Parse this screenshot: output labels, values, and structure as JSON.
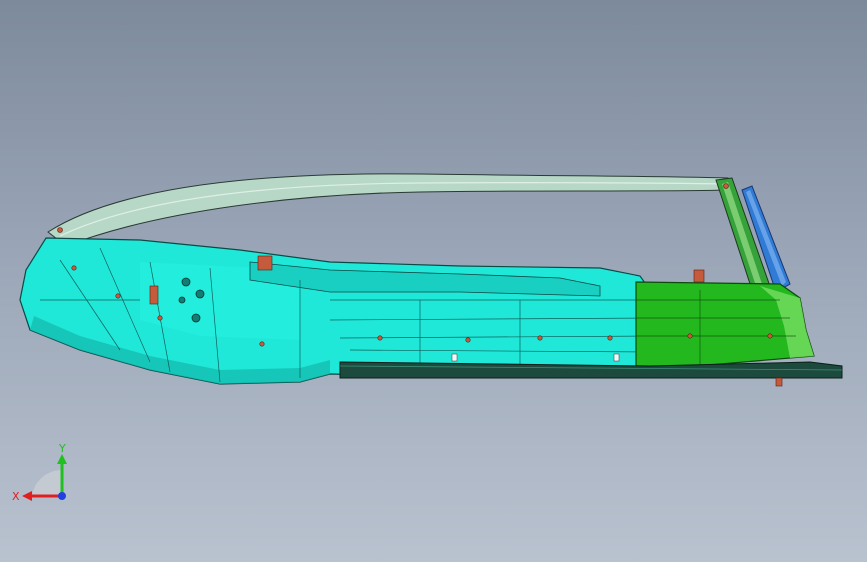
{
  "viewport": {
    "background_top": "#7d8a9c",
    "background_bottom": "#b9c2cf"
  },
  "model": {
    "part_colors": {
      "main_body": "#1fe8d8",
      "rear_section": "#22b81e",
      "frame_rail": "#b9d9c9",
      "bracket": "#2f7bd6",
      "fastener": "#c65a3c"
    }
  },
  "triad": {
    "x_label": "X",
    "y_label": "Y",
    "x_color": "#e02020",
    "y_color": "#20c020",
    "z_color": "#2040e0"
  }
}
